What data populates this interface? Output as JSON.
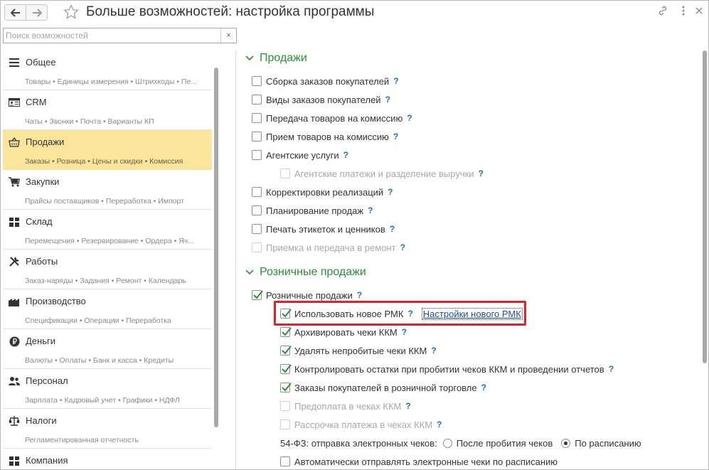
{
  "header": {
    "title": "Больше возможностей: настройка программы"
  },
  "search": {
    "placeholder": "Поиск возможностей",
    "clear_label": "×"
  },
  "sidebar": {
    "items": [
      {
        "label": "Общее",
        "desc": "Товары • Единицы измерения • Штрихкоды • Пе...",
        "icon": "list-icon"
      },
      {
        "label": "CRM",
        "desc": "Чаты • Звонки • Почта • Варианты КП",
        "icon": "contact-card-icon"
      },
      {
        "label": "Продажи",
        "desc": "Заказы • Розница • Цены и скидки • Комиссия",
        "icon": "shop-basket-icon"
      },
      {
        "label": "Закупки",
        "desc": "Прайсы поставщиков • Переработка • Импорт",
        "icon": "cart-icon"
      },
      {
        "label": "Склад",
        "desc": "Перемещения • Резервирование • Ордера • Яч...",
        "icon": "warehouse-grid-icon"
      },
      {
        "label": "Работы",
        "desc": "Заказ-наряды • Задания • Ремонт • Календарь",
        "icon": "tools-icon"
      },
      {
        "label": "Производство",
        "desc": "Спецификации • Операции • Переработка",
        "icon": "factory-icon"
      },
      {
        "label": "Деньги",
        "desc": "Валюты • Оплаты • Банк и касса • Кредиты",
        "icon": "ruble-coin-icon"
      },
      {
        "label": "Персонал",
        "desc": "Зарплата • Кадровый учет • Графики • НДФЛ",
        "icon": "people-icon"
      },
      {
        "label": "Налоги",
        "desc": "Регламентированная отчетность",
        "icon": "scales-icon"
      },
      {
        "label": "Компания",
        "desc": "",
        "icon": "company-grid-icon"
      }
    ]
  },
  "main": {
    "sales": {
      "title": "Продажи",
      "options": [
        {
          "label": "Сборка заказов покупателей",
          "checked": false,
          "disabled": false,
          "q": "?"
        },
        {
          "label": "Виды заказов покупателей",
          "checked": false,
          "disabled": false,
          "q": "?"
        },
        {
          "label": "Передача товаров на комиссию",
          "checked": false,
          "disabled": false,
          "q": "?"
        },
        {
          "label": "Прием товаров на комиссию",
          "checked": false,
          "disabled": false,
          "q": "?"
        },
        {
          "label": "Агентские услуги",
          "checked": false,
          "disabled": false,
          "q": "?"
        },
        {
          "label": "Агентские платежи и разделение выручки",
          "checked": false,
          "disabled": true,
          "q": "?"
        },
        {
          "label": "Корректировки реализаций",
          "checked": false,
          "disabled": false,
          "q": "?"
        },
        {
          "label": "Планирование продаж",
          "checked": false,
          "disabled": false,
          "q": "?"
        },
        {
          "label": "Печать этикеток и ценников",
          "checked": false,
          "disabled": false,
          "q": "?"
        },
        {
          "label": "Приемка и передача в ремонт",
          "checked": false,
          "disabled": true,
          "q": "?"
        }
      ]
    },
    "retail": {
      "title": "Розничные продажи",
      "options": [
        {
          "label": "Розничные продажи",
          "checked": true,
          "disabled": false,
          "q": "?"
        },
        {
          "label": "Использовать новое РМК",
          "checked": true,
          "disabled": false,
          "q": "?",
          "link": "Настройки нового РМК"
        },
        {
          "label": "Архивировать чеки ККМ",
          "checked": true,
          "disabled": false,
          "q": "?"
        },
        {
          "label": "Удалять непробитые чеки ККМ",
          "checked": true,
          "disabled": false,
          "q": "?"
        },
        {
          "label": "Контролировать остатки при пробитии чеков ККМ и проведении отчетов",
          "checked": true,
          "disabled": false,
          "q": "?"
        },
        {
          "label": "Заказы покупателей в розничной торговле",
          "checked": true,
          "disabled": false,
          "q": "?"
        },
        {
          "label": "Предоплата в чеках ККМ",
          "checked": false,
          "disabled": true,
          "q": "?"
        },
        {
          "label": "Рассрочка платежа в чеках ККМ",
          "checked": false,
          "disabled": true,
          "q": "?"
        }
      ],
      "fz54": {
        "label": "54-ФЗ: отправка электронных чеков:",
        "opt1": "После пробития чеков",
        "opt2": "По расписанию",
        "selected": "По расписанию"
      },
      "auto_send": {
        "label": "Автоматически отправлять электронные чеки по расписанию",
        "checked": false
      }
    }
  },
  "colors": {
    "accent_green": "#2a8f3a",
    "active_bg": "#fbe59b",
    "help_blue": "#1f6fb5",
    "highlight_red": "#d9262b"
  }
}
